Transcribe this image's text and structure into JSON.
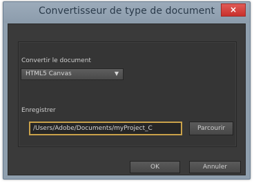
{
  "window": {
    "title": "Convertisseur de type de document",
    "close_label": "×"
  },
  "form": {
    "convert_label": "Convertir le document",
    "convert_value": "HTML5 Canvas",
    "save_label": "Enregistrer",
    "save_path": "/Users/Adobe/Documents/myProject_C",
    "browse_label": "Parcourir"
  },
  "buttons": {
    "ok_label": "OK",
    "cancel_label": "Annuler"
  }
}
